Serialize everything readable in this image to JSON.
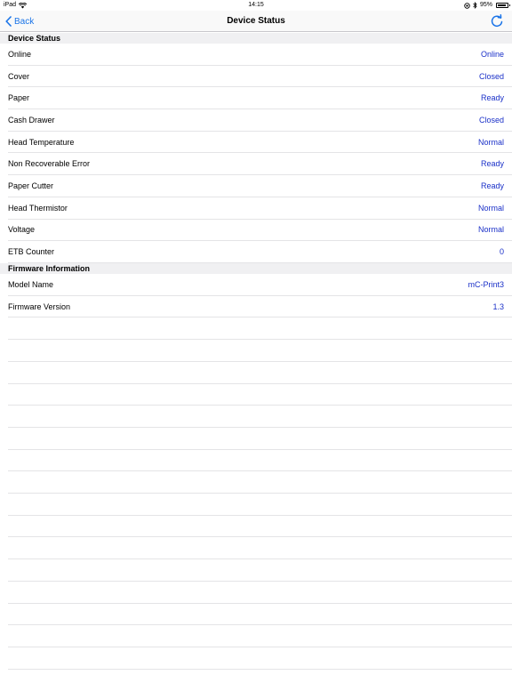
{
  "status_bar": {
    "device": "iPad",
    "time": "14:15",
    "battery_text": "95%",
    "battery_level": 0.95
  },
  "nav": {
    "back_label": "Back",
    "title": "Device Status"
  },
  "sections": [
    {
      "header": "Device Status",
      "rows": [
        {
          "label": "Online",
          "value": "Online"
        },
        {
          "label": "Cover",
          "value": "Closed"
        },
        {
          "label": "Paper",
          "value": "Ready"
        },
        {
          "label": "Cash Drawer",
          "value": "Closed"
        },
        {
          "label": "Head Temperature",
          "value": "Normal"
        },
        {
          "label": "Non Recoverable Error",
          "value": "Ready"
        },
        {
          "label": "Paper Cutter",
          "value": "Ready"
        },
        {
          "label": "Head Thermistor",
          "value": "Normal"
        },
        {
          "label": "Voltage",
          "value": "Normal"
        },
        {
          "label": "ETB Counter",
          "value": "0"
        }
      ]
    },
    {
      "header": "Firmware Information",
      "rows": [
        {
          "label": "Model Name",
          "value": "mC-Print3"
        },
        {
          "label": "Firmware Version",
          "value": "1.3"
        }
      ]
    }
  ],
  "colors": {
    "accent": "#1a74e8",
    "value_text": "#1a30c8",
    "section_bg": "#f0f0f2",
    "separator": "#e4e4e6"
  }
}
